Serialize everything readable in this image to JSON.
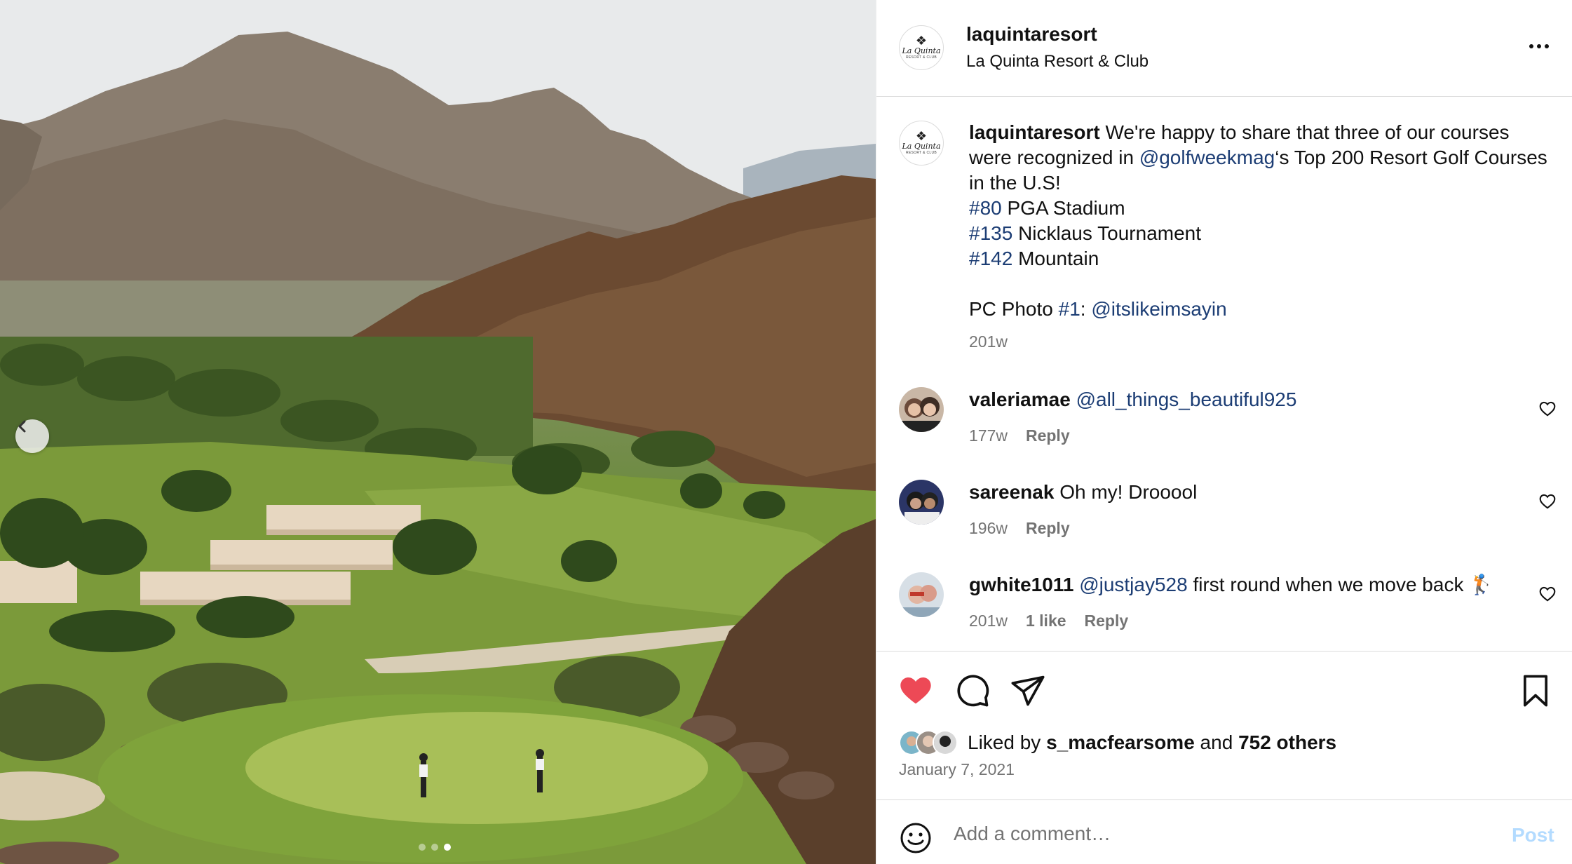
{
  "post": {
    "username": "laquintaresort",
    "fullname": "La Quinta Resort & Club",
    "more_label": "More options"
  },
  "logo": {
    "mark": "❖",
    "wordmark": "La Quinta",
    "sub": "RESORT & CLUB"
  },
  "caption": {
    "username": "laquintaresort",
    "line1_text": " We're happy to share that three of our courses were recognized in ",
    "mention": "@golfweekmag",
    "line1_rest": "‘s Top 200 Resort Golf Courses in the U.S!",
    "rank1_tag": "#80",
    "rank1_name": " PGA Stadium",
    "rank2_tag": "#135",
    "rank2_name": " Nicklaus Tournament",
    "rank3_tag": "#142",
    "rank3_name": " Mountain",
    "credit_prefix": "PC Photo ",
    "credit_tag": "#1",
    "credit_sep": ": ",
    "credit_mention": "@itslikeimsayin",
    "time": "201w"
  },
  "comments": [
    {
      "username": "valeriamae",
      "text_mention": "@all_things_beautiful925",
      "text": "",
      "time": "177w",
      "likes": "",
      "reply": "Reply"
    },
    {
      "username": "sareenak",
      "text_mention": "",
      "text": " Oh my! Drooool",
      "time": "196w",
      "likes": "",
      "reply": "Reply"
    },
    {
      "username": "gwhite1011",
      "text_mention": "@justjay528",
      "text": " first round when we move back 🏌",
      "time": "201w",
      "likes": "1 like",
      "reply": "Reply"
    }
  ],
  "likes": {
    "prefix": "Liked by ",
    "user": "s_macfearsome",
    "middle": " and ",
    "others": "752 others"
  },
  "date": "January 7, 2021",
  "add_comment": {
    "placeholder": "Add a comment…",
    "post_label": "Post"
  },
  "carousel": {
    "count": 3,
    "active_index": 2
  },
  "colors": {
    "like": "#ed4956",
    "link": "#1c3d74",
    "meta": "#737373",
    "post_disabled": "#b3dbff"
  }
}
